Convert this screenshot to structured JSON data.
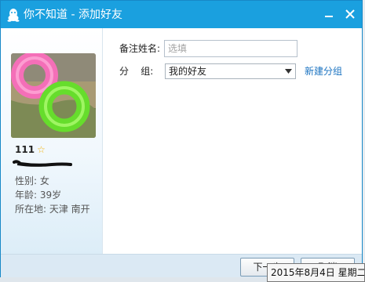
{
  "window": {
    "title": "你不知道 - 添加好友"
  },
  "colors": {
    "titlebar": "#1aa0df",
    "link": "#1b73c1",
    "star": "#f2b20b"
  },
  "title_icon": "qq-penguin-icon",
  "profile": {
    "nickname": "111",
    "badge_icon": "star-icon",
    "gender": "性别: 女",
    "age": "年龄: 39岁",
    "location": "所在地: 天津  南开"
  },
  "form": {
    "remark_label": "备注姓名:",
    "remark_placeholder": "选填",
    "group_label": "分    组:",
    "group_value": "我的好友",
    "new_group_link": "新建分组"
  },
  "buttons": {
    "next": "下一步",
    "cancel": "取消"
  },
  "tooltip": "2015年8月4日 星期二"
}
